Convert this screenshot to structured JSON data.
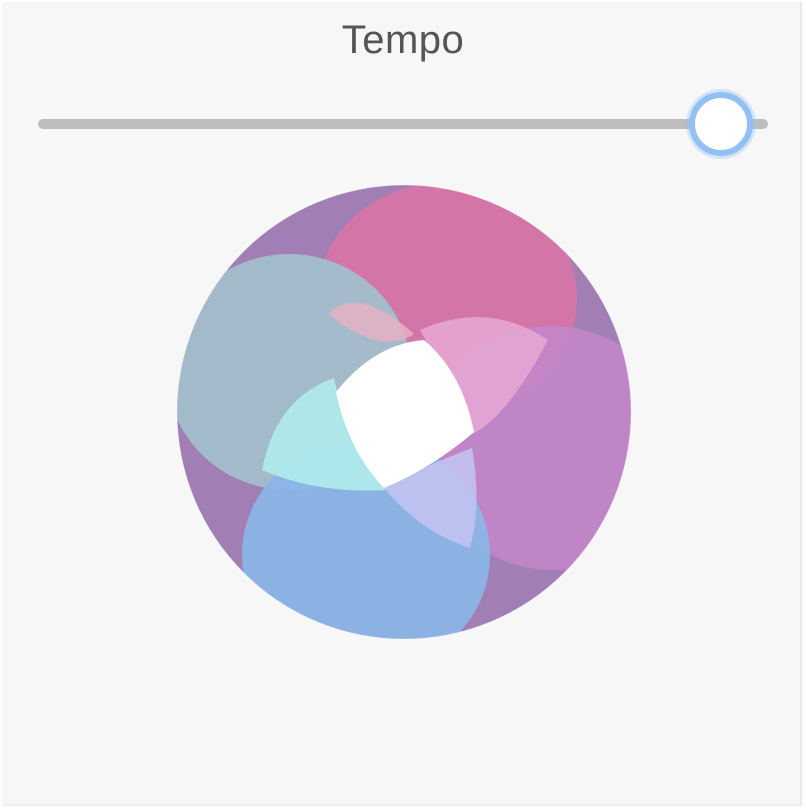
{
  "control": {
    "title": "Tempo",
    "slider_level": 0.93
  },
  "visual": {
    "name": "overlapping-circles-graphic",
    "colors": {
      "base": "#a17fb5",
      "top_pink": "#d676a6",
      "left_gray_blue": "#a2bccb",
      "right_purple": "#c285c9",
      "bottom_blue": "#8bb5e6",
      "center": "#ffffff"
    }
  }
}
